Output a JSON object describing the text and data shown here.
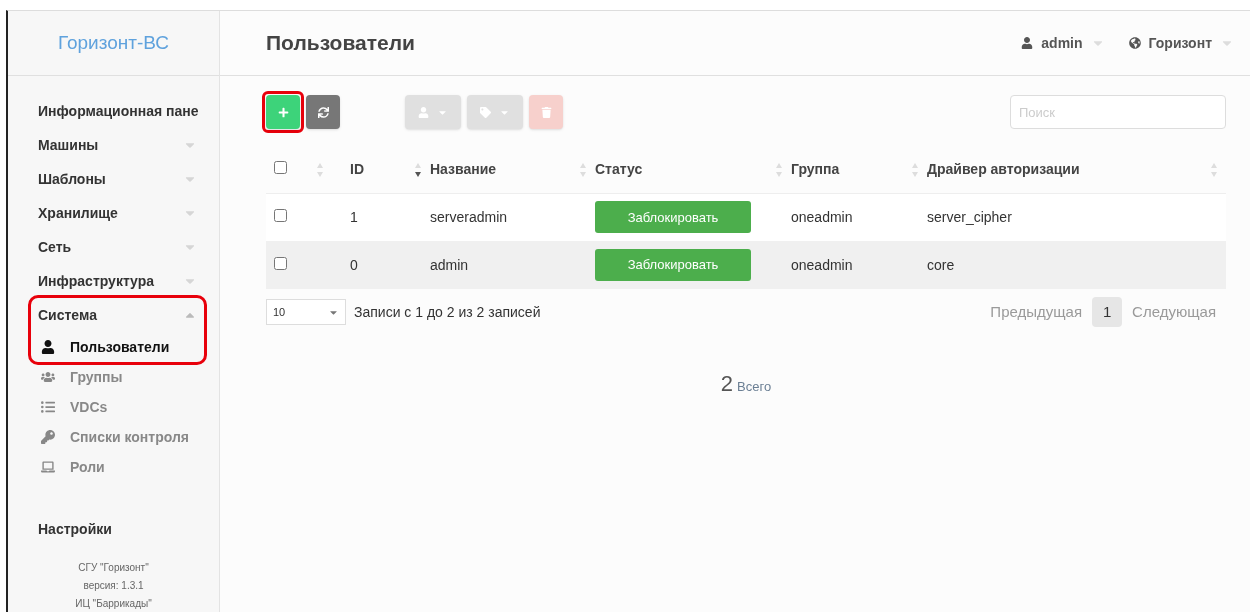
{
  "sidebar": {
    "logo": "Горизонт-ВС",
    "items": [
      {
        "label": "Информационная пане",
        "kind": "link"
      },
      {
        "label": "Машины",
        "kind": "menu",
        "expanded": false
      },
      {
        "label": "Шаблоны",
        "kind": "menu",
        "expanded": false
      },
      {
        "label": "Хранилище",
        "kind": "menu",
        "expanded": false
      },
      {
        "label": "Сеть",
        "kind": "menu",
        "expanded": false
      },
      {
        "label": "Инфраструктура",
        "kind": "menu",
        "expanded": false
      },
      {
        "label": "Система",
        "kind": "menu",
        "expanded": true,
        "highlighted": true,
        "children": [
          {
            "label": "Пользователи",
            "selected": true
          },
          {
            "label": "Группы",
            "selected": false
          },
          {
            "label": "VDCs",
            "selected": false
          },
          {
            "label": "Списки контроля",
            "selected": false
          },
          {
            "label": "Роли",
            "selected": false
          }
        ]
      },
      {
        "label": "Настройки",
        "kind": "link"
      }
    ],
    "footer": [
      "СГУ \"Горизонт\"",
      "версия: 1.3.1",
      "ИЦ \"Баррикады\""
    ]
  },
  "header": {
    "title": "Пользователи",
    "user": "admin",
    "zone": "Горизонт"
  },
  "toolbar": {
    "buttons": [
      {
        "kind": "add",
        "disabled": false,
        "highlighted": true
      },
      {
        "kind": "refresh",
        "disabled": false,
        "highlighted": false
      },
      {
        "kind": "user-menu",
        "disabled": true,
        "highlighted": false
      },
      {
        "kind": "tag-menu",
        "disabled": true,
        "highlighted": false
      },
      {
        "kind": "delete",
        "disabled": true,
        "highlighted": false
      }
    ],
    "search": {
      "placeholder": "Поиск"
    }
  },
  "table": {
    "all_checked": false,
    "columns": [
      {
        "label": "ID",
        "sorted": true
      },
      {
        "label": "Название",
        "sorted": false
      },
      {
        "label": "Статус",
        "sorted": false
      },
      {
        "label": "Группа",
        "sorted": false
      },
      {
        "label": "Драйвер авторизации",
        "sorted": false
      }
    ],
    "rows": [
      {
        "checked": false,
        "id": "1",
        "name": "serveradmin",
        "status": "Заблокировать",
        "group": "oneadmin",
        "driver": "server_cipher"
      },
      {
        "checked": false,
        "id": "0",
        "name": "admin",
        "status": "Заблокировать",
        "group": "oneadmin",
        "driver": "core"
      }
    ]
  },
  "pagination": {
    "page_size": "10",
    "info": "Записи с 1 до 2 из 2 записей",
    "previous": "Предыдущая",
    "pages": [
      {
        "label": "1",
        "selected": true
      }
    ],
    "next": "Следующая"
  },
  "total": {
    "count": "2",
    "label": "Всего"
  }
}
